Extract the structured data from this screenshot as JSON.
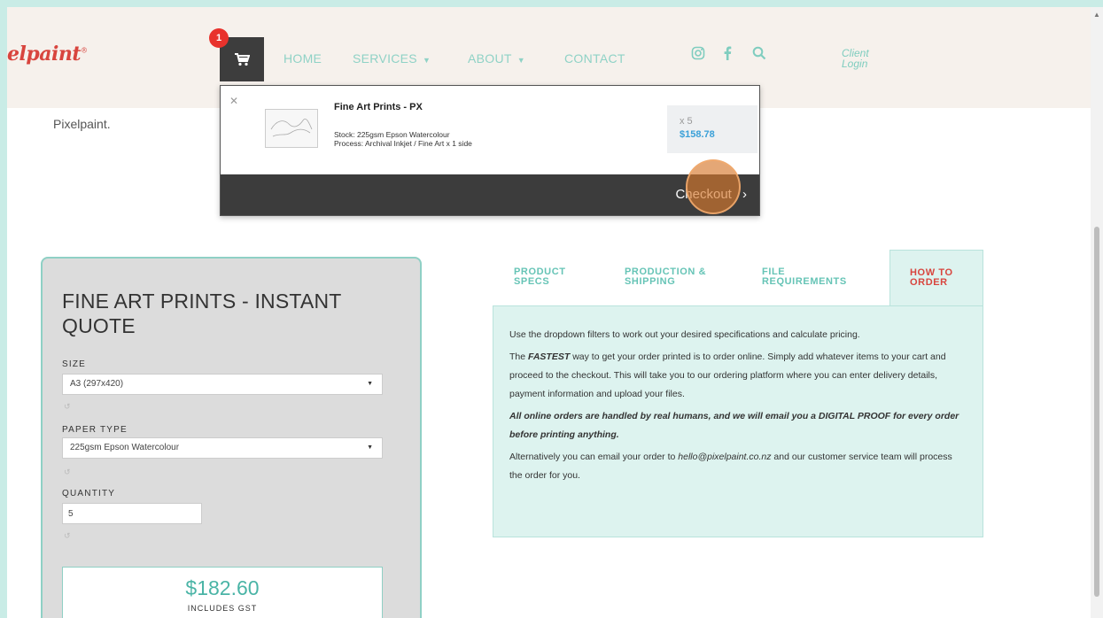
{
  "brand": {
    "logo_text": "elpaint",
    "logo_mark": "®"
  },
  "cart": {
    "count": "1"
  },
  "nav": {
    "home": "HOME",
    "services": "SERVICES",
    "about": "ABOUT",
    "contact": "CONTACT",
    "client_login_line1": "Client",
    "client_login_line2": "Login"
  },
  "intro_text": "Pixelpaint.",
  "cart_dropdown": {
    "item_title": "Fine Art Prints - PX",
    "stock": "Stock: 225gsm Epson Watercolour",
    "process": "Process: Archival Inkjet / Fine Art x 1 side",
    "qty": "x 5",
    "price": "$158.78",
    "checkout": "Checkout"
  },
  "quote": {
    "title": "FINE ART PRINTS - INSTANT QUOTE",
    "size_label": "SIZE",
    "size_value": "A3 (297x420)",
    "paper_label": "PAPER TYPE",
    "paper_value": "225gsm Epson Watercolour",
    "quantity_label": "QUANTITY",
    "quantity_value": "5",
    "total": "$182.60",
    "gst_note": "INCLUDES GST"
  },
  "tabs": {
    "product_specs_1": "PRODUCT",
    "product_specs_2": "SPECS",
    "production_1": "PRODUCTION &",
    "production_2": "SHIPPING",
    "file_1": "FILE",
    "file_2": "REQUIREMENTS",
    "how_1": "HOW TO",
    "how_2": "ORDER"
  },
  "how_to_order": {
    "p1": "Use the dropdown filters to work out your desired specifications and calculate pricing.",
    "p2_pre": "The ",
    "p2_em": "FASTEST",
    "p2_post": " way to get your order printed is to order online. Simply add whatever items to your cart and proceed to the checkout. This will take you to our ordering platform where you can enter delivery details, payment information and upload your files.",
    "p3": "All online orders are handled by real humans, and we will email you a DIGITAL PROOF for every order before printing anything.",
    "p4_pre": "Alternatively you can email your order to ",
    "p4_email": "hello@pixelpaint.co.nz",
    "p4_post": " and our customer service team will process the order for you."
  },
  "colors": {
    "accent": "#7fcdbf",
    "brand_red": "#d8453e",
    "price_blue": "#3aa0d8",
    "dark": "#3c3c3c"
  },
  "icons": [
    "cart-icon",
    "instagram-icon",
    "facebook-icon",
    "search-icon",
    "close-icon",
    "chevron-right-icon",
    "chevron-down-icon",
    "undo-icon"
  ]
}
